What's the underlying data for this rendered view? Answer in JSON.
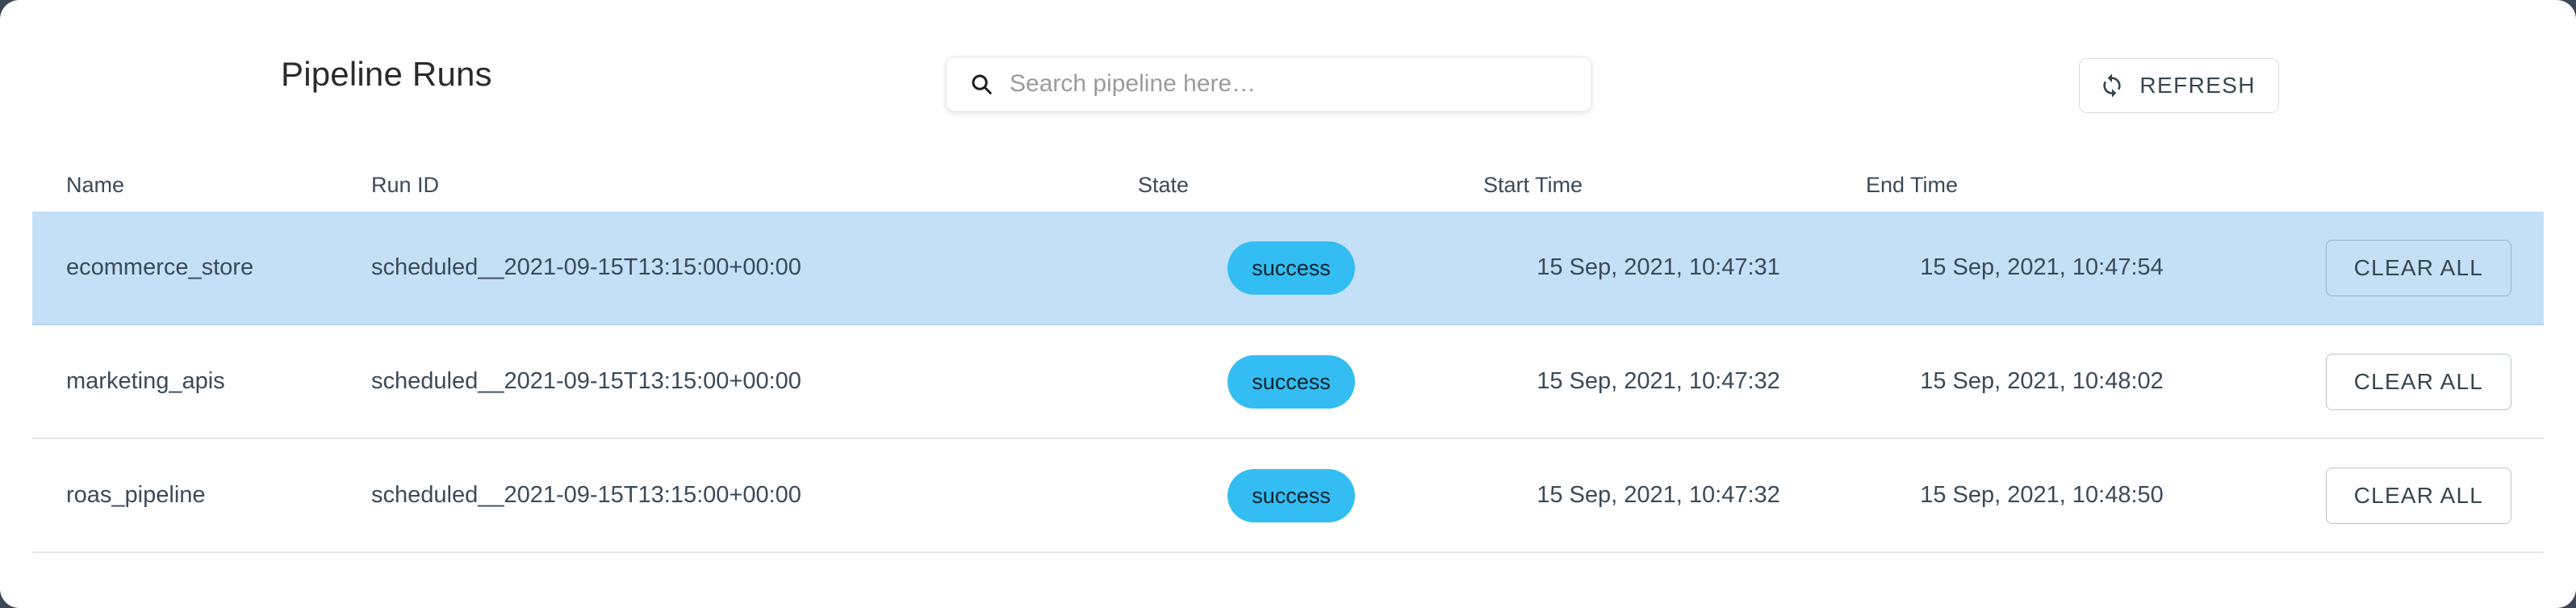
{
  "toolbar": {
    "title": "Pipeline Runs",
    "search": {
      "icon": "search-icon",
      "value": "",
      "placeholder": "Search pipeline here…"
    },
    "refresh": {
      "icon": "refresh-icon",
      "label": "REFRESH"
    }
  },
  "table": {
    "columns": [
      {
        "key": "name",
        "label": "Name"
      },
      {
        "key": "run_id",
        "label": "Run ID"
      },
      {
        "key": "state",
        "label": "State"
      },
      {
        "key": "start",
        "label": "Start Time"
      },
      {
        "key": "end",
        "label": "End Time"
      },
      {
        "key": "action",
        "label": ""
      }
    ],
    "action_label": "CLEAR ALL",
    "rows": [
      {
        "name": "ecommerce_store",
        "run_id": "scheduled__2021-09-15T13:15:00+00:00",
        "state": "success",
        "start": "15 Sep, 2021, 10:47:31",
        "end": "15 Sep, 2021, 10:47:54",
        "action": "CLEAR ALL",
        "selected": true
      },
      {
        "name": "marketing_apis",
        "run_id": "scheduled__2021-09-15T13:15:00+00:00",
        "state": "success",
        "start": "15 Sep, 2021, 10:47:32",
        "end": "15 Sep, 2021, 10:48:02",
        "action": "CLEAR ALL",
        "selected": false
      },
      {
        "name": "roas_pipeline",
        "run_id": "scheduled__2021-09-15T13:15:00+00:00",
        "state": "success",
        "start": "15 Sep, 2021, 10:47:32",
        "end": "15 Sep, 2021, 10:48:50",
        "action": "CLEAR ALL",
        "selected": false
      }
    ]
  },
  "colors": {
    "selected_row": "#c3e0f7",
    "state_success": "#33bdf2",
    "text_primary": "#3b4a59",
    "page_background": "#3c4858"
  }
}
